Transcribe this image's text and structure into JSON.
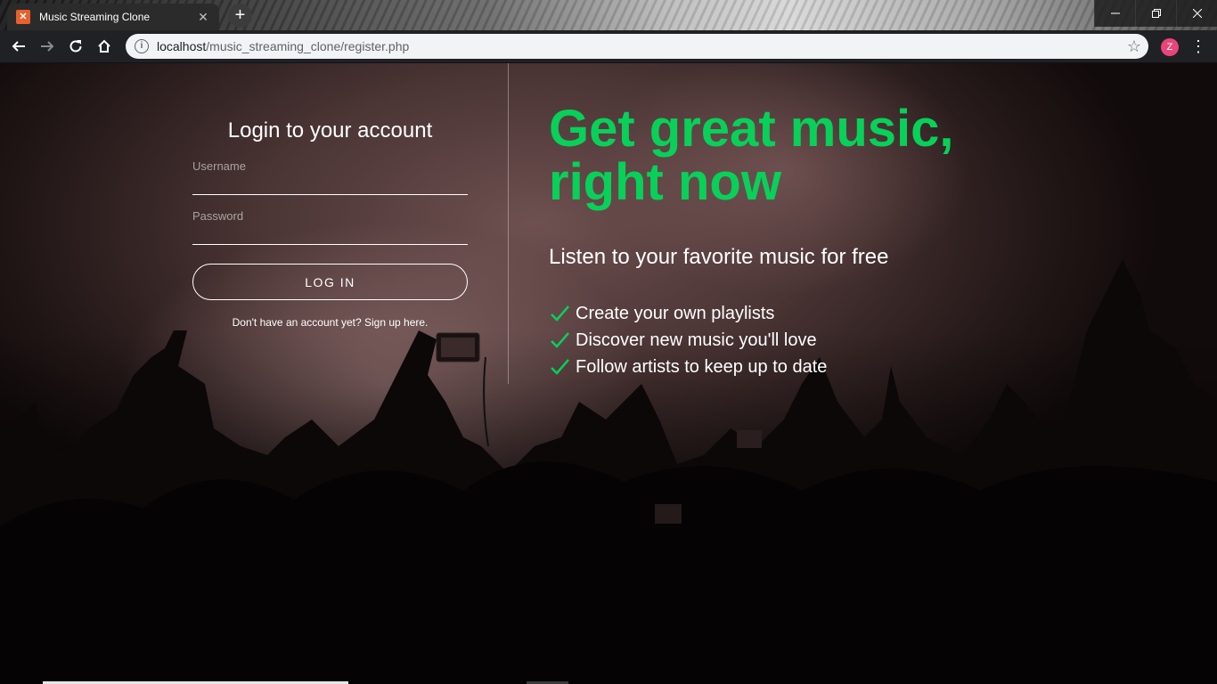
{
  "browser": {
    "tab_title": "Music Streaming Clone",
    "tab_favicon_text": "⌘",
    "new_tab_label": "+",
    "url_host": "localhost",
    "url_path": "/music_streaming_clone/register.php",
    "profile_initial": "Z",
    "window_controls": [
      "minimize",
      "restore",
      "close"
    ]
  },
  "login": {
    "title": "Login to your account",
    "username_label": "Username",
    "username_value": "",
    "password_label": "Password",
    "password_value": "",
    "button_label": "LOG IN",
    "signup_text": "Don't have an account yet? Sign up here."
  },
  "hero": {
    "headline": "Get great music, right now",
    "subheadline": "Listen to your favorite music for free",
    "features": [
      "Create your own playlists",
      "Discover new music you'll love",
      "Follow artists to keep up to date"
    ]
  },
  "colors": {
    "accent_green": "#07d159",
    "text_white": "#ffffff",
    "chrome_dark": "#202124"
  },
  "icons": [
    "back-arrow-icon",
    "forward-arrow-icon",
    "reload-icon",
    "home-icon",
    "info-icon",
    "star-icon",
    "menu-dots-icon",
    "checkmark-icon"
  ]
}
